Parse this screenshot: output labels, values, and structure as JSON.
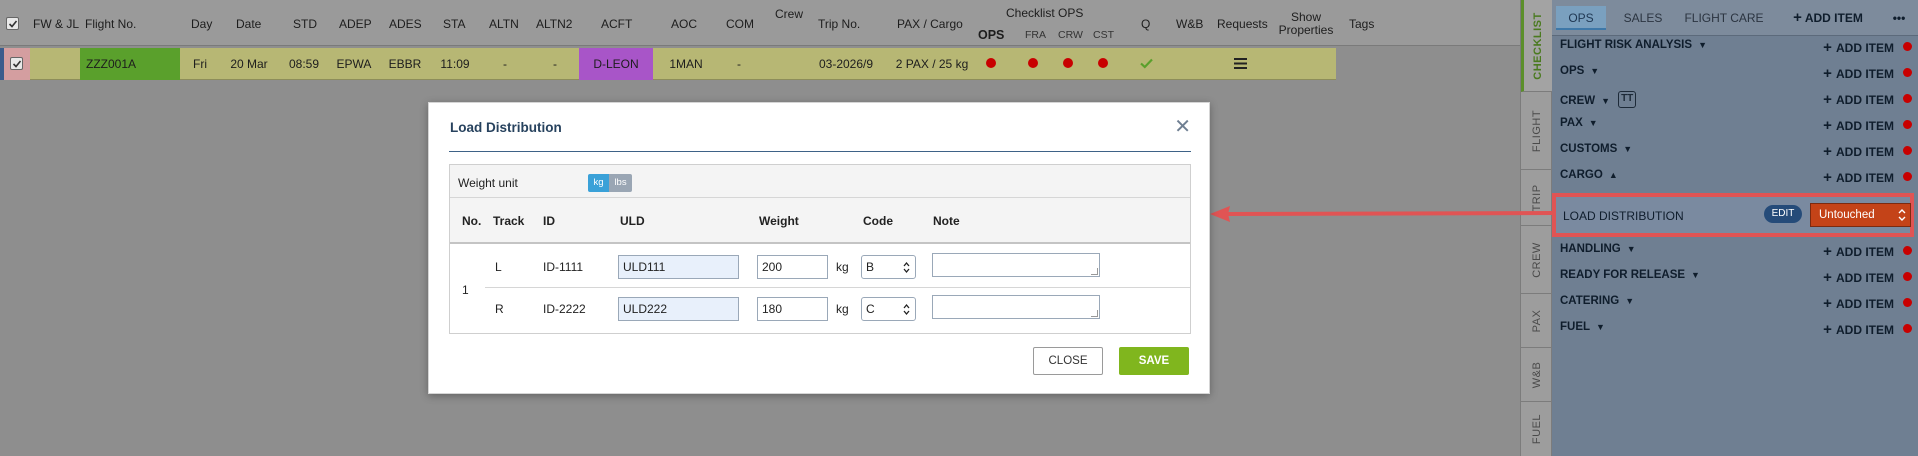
{
  "table": {
    "headers": {
      "fwjl": "FW & JL",
      "flight_no": "Flight No.",
      "day": "Day",
      "date": "Date",
      "std": "STD",
      "adep": "ADEP",
      "ades": "ADES",
      "sta": "STA",
      "altn": "ALTN",
      "altn2": "ALTN2",
      "acft": "ACFT",
      "aoc": "AOC",
      "com": "COM",
      "crew": "Crew",
      "trip_no": "Trip No.",
      "pax_cargo": "PAX / Cargo",
      "checklist_ops": "Checklist OPS",
      "ops": "OPS",
      "fra": "FRA",
      "crw": "CRW",
      "cst": "CST",
      "q": "Q",
      "wb": "W&B",
      "requests": "Requests",
      "show_properties": "Show Properties",
      "tags": "Tags"
    },
    "row": {
      "flight_no": "ZZZ001A",
      "day": "Fri",
      "date": "20 Mar",
      "std": "08:59",
      "adep": "EPWA",
      "ades": "EBBR",
      "sta": "11:09",
      "altn": "-",
      "altn2": "-",
      "acft": "D-LEON",
      "aoc": "1MAN",
      "com": "-",
      "trip_no": "03-2026/9",
      "pax_cargo": "2 PAX / 25 kg",
      "flight_color": "#5aa02c",
      "acft_color": "#a855c8",
      "row_color": "#b7b774"
    }
  },
  "vertical_tabs": [
    "CHECKLIST",
    "FLIGHT",
    "TRIP",
    "CREW",
    "PAX",
    "W&B",
    "FUEL"
  ],
  "panel": {
    "tabs": {
      "ops": "OPS",
      "sales": "SALES",
      "flight_care": "FLIGHT CARE",
      "add_item": "ADD ITEM",
      "more": "•••"
    },
    "add_item_label": "ADD ITEM",
    "sections": [
      "FLIGHT RISK ANALYSIS",
      "OPS",
      "CREW",
      "PAX",
      "CUSTOMS",
      "CARGO",
      "HANDLING",
      "READY FOR RELEASE",
      "CATERING",
      "FUEL"
    ],
    "load_distribution": {
      "label": "LOAD DISTRIBUTION",
      "edit": "EDIT",
      "status": "Untouched",
      "status_color": "#c44318"
    }
  },
  "modal": {
    "title": "Load Distribution",
    "weight_unit_label": "Weight unit",
    "unit_kg": "kg",
    "unit_lbs": "lbs",
    "columns": {
      "no": "No.",
      "track": "Track",
      "id": "ID",
      "uld": "ULD",
      "weight": "Weight",
      "code": "Code",
      "note": "Note"
    },
    "group_no": "1",
    "rows": [
      {
        "track": "L",
        "id": "ID-1111",
        "uld": "ULD111",
        "weight": "200",
        "unit": "kg",
        "code": "B"
      },
      {
        "track": "R",
        "id": "ID-2222",
        "uld": "ULD222",
        "weight": "180",
        "unit": "kg",
        "code": "C"
      }
    ],
    "close_label": "CLOSE",
    "save_label": "SAVE"
  }
}
